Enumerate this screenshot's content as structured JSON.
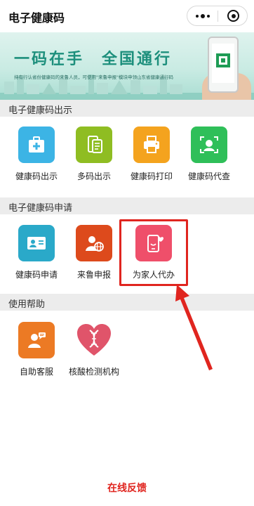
{
  "header": {
    "title": "电子健康码"
  },
  "banner": {
    "slogan": "一码在手　全国通行",
    "subtitle": "持有行认省份健康码的来鲁人员，可使用\"来鲁申报\"模块申领山东省健康通行码"
  },
  "sections": {
    "show": {
      "title": "电子健康码出示"
    },
    "apply": {
      "title": "电子健康码申请"
    },
    "help": {
      "title": "使用帮助"
    }
  },
  "items": {
    "show_code": {
      "label": "健康码出示",
      "icon": "medical-kit-icon",
      "color": "#3cb4e5"
    },
    "multi_code": {
      "label": "多码出示",
      "icon": "phone-cards-icon",
      "color": "#8fbd22"
    },
    "print_code": {
      "label": "健康码打印",
      "icon": "printer-icon",
      "color": "#f4a31e"
    },
    "proxy_code": {
      "label": "健康码代查",
      "icon": "face-scan-icon",
      "color": "#2fbf59"
    },
    "apply_code": {
      "label": "健康码申请",
      "icon": "id-card-icon",
      "color": "#2aa9c9"
    },
    "shandong_report": {
      "label": "来鲁申报",
      "icon": "person-globe-icon",
      "color": "#dd4a1c"
    },
    "family_agent": {
      "label": "为家人代办",
      "icon": "phone-heart-icon",
      "color": "#ef4f6a"
    },
    "self_service": {
      "label": "自助客服",
      "icon": "support-agent-icon",
      "color": "#ec7a24"
    },
    "test_sites": {
      "label": "核酸检测机构",
      "icon": "dna-heart-icon",
      "color": "#e0546a"
    }
  },
  "footer": {
    "feedback_label": "在线反馈"
  },
  "annotation": {
    "highlight_color": "#e0251f"
  }
}
